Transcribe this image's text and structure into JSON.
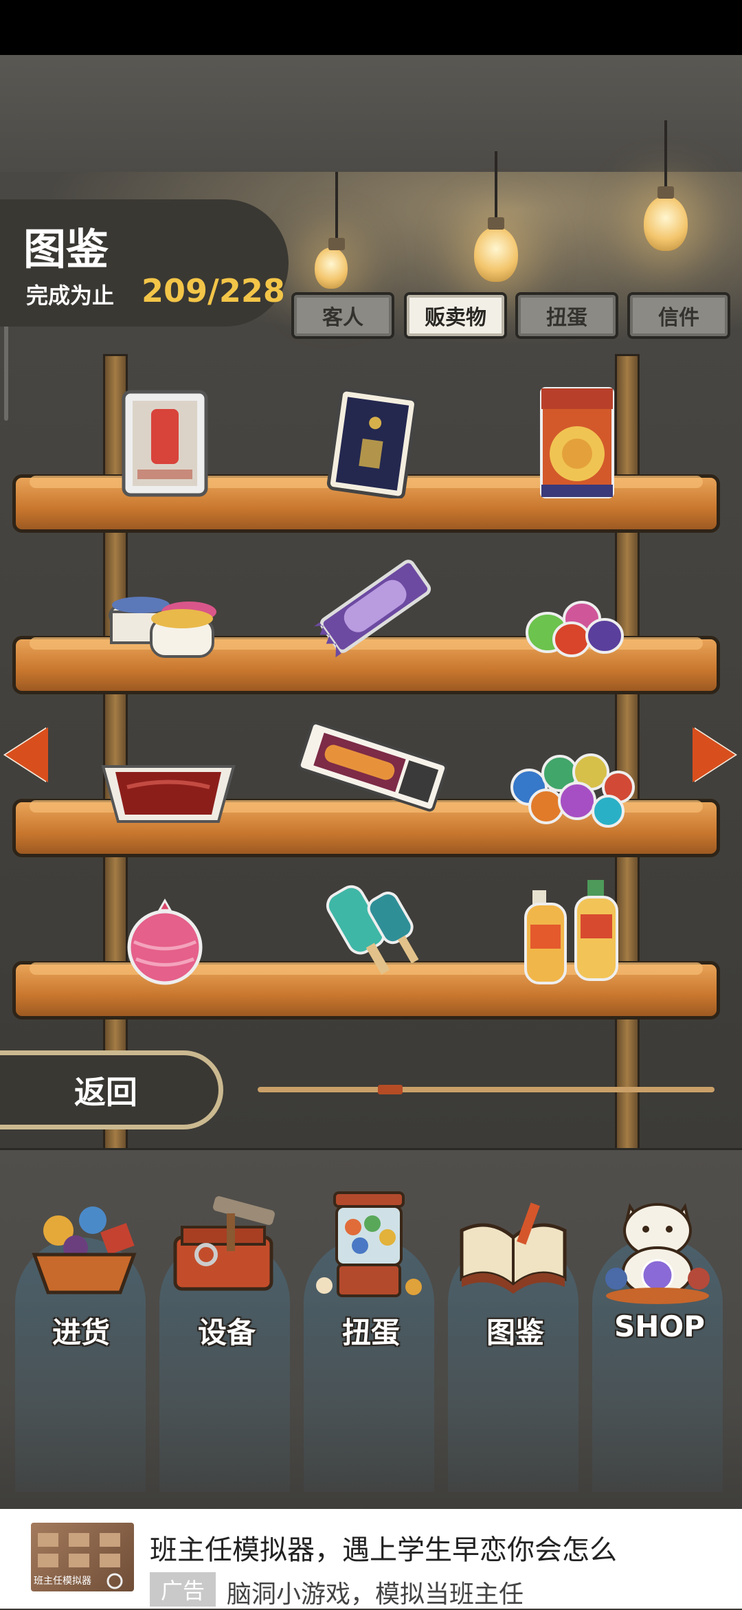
{
  "header": {
    "title": "图鉴",
    "progress_label": "完成为止",
    "progress_value": "209/228",
    "progress": {
      "collected": 209,
      "total": 228
    }
  },
  "tabs": [
    {
      "label": "客人",
      "active": false
    },
    {
      "label": "贩卖物",
      "active": true
    },
    {
      "label": "扭蛋",
      "active": false
    },
    {
      "label": "信件",
      "active": false
    }
  ],
  "shelf_items": [
    {
      "name": "boxed-drink-card"
    },
    {
      "name": "navy-charm-card"
    },
    {
      "name": "round-snack-bag"
    },
    {
      "name": "pudding-cups"
    },
    {
      "name": "purple-wrapped-candy"
    },
    {
      "name": "gummy-drops"
    },
    {
      "name": "jelly-tray"
    },
    {
      "name": "stick-snack-pack"
    },
    {
      "name": "marble-candies"
    },
    {
      "name": "pink-water-balloon"
    },
    {
      "name": "ice-pops"
    },
    {
      "name": "fruit-milk-bottles"
    }
  ],
  "back_button": {
    "label": "返回"
  },
  "pagination": {
    "current_page_fraction": 0.27
  },
  "bottom_nav": [
    {
      "label": "进货",
      "icon": "stock-basket-icon"
    },
    {
      "label": "设备",
      "icon": "toolbox-icon"
    },
    {
      "label": "扭蛋",
      "icon": "gacha-machine-icon"
    },
    {
      "label": "图鉴",
      "icon": "open-book-icon"
    },
    {
      "label": "SHOP",
      "icon": "lucky-cat-icon"
    }
  ],
  "ad": {
    "title": "班主任模拟器，遇上学生早恋你会怎么",
    "badge": "广告",
    "description": "脑洞小游戏，模拟当班主任",
    "thumb_caption": "班主任模拟器"
  },
  "colors": {
    "accent_yellow": "#f3c548",
    "arrow": "#d84f1d",
    "wood": "#c9772e"
  }
}
